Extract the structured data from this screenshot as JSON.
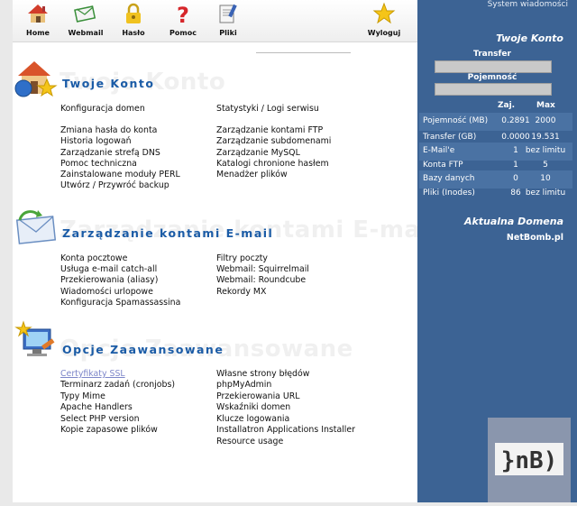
{
  "toolbar": {
    "home": "Home",
    "webmail": "Webmail",
    "password": "Hasło",
    "help": "Pomoc",
    "files": "Pliki",
    "logout": "Wyloguj"
  },
  "account": {
    "ghost": "Twoje Konto",
    "title": "Twoje Konto",
    "left": [
      "Konfiguracja domen",
      "Zmiana hasła do konta",
      "Historia logowań",
      "Zarządzanie strefą DNS",
      "Pomoc techniczna",
      "Zainstalowane moduły PERL",
      "Utwórz / Przywróć backup"
    ],
    "right": [
      "Statystyki / Logi serwisu",
      "Zarządzanie kontami FTP",
      "Zarządzanie subdomenami",
      "Zarządzanie MySQL",
      "Katalogi chronione hasłem",
      "Menadżer plików"
    ]
  },
  "email": {
    "ghost": "Zarządzanie kontami E-mail",
    "title": "Zarządzanie kontami E-mail",
    "left": [
      "Konta pocztowe",
      "Usługa e-mail catch-all",
      "Przekierowania (aliasy)",
      "Wiadomości urlopowe",
      "Konfiguracja Spamassassina"
    ],
    "right": [
      "Filtry poczty",
      "Webmail: Squirrelmail",
      "Webmail: Roundcube",
      "Rekordy MX"
    ]
  },
  "advanced": {
    "ghost": "Opcje Zaawansowane",
    "title": "Opcje Zaawansowane",
    "left": [
      "Certyfikaty SSL",
      "Terminarz zadań (cronjobs)",
      "Typy Mime",
      "Apache Handlers",
      "Select PHP version",
      "Kopie zapasowe plików"
    ],
    "right": [
      "Własne strony błędów",
      "phpMyAdmin",
      "Przekierowania URL",
      "Wskaźniki domen",
      "Klucze logowania",
      "Installatron Applications Installer",
      "Resource usage"
    ]
  },
  "sidebar": {
    "system_messages": "System wiadomości",
    "account_title": "Twoje Konto",
    "transfer_label": "Transfer",
    "capacity_label": "Pojemność",
    "col_used": "Zaj.",
    "col_max": "Max",
    "stats": [
      {
        "name": "Pojemność (MB)",
        "used": "0.2891",
        "max": "2000"
      },
      {
        "name": "Transfer (GB)",
        "used": "0.0000",
        "max": "19.531"
      },
      {
        "name": "E-Mail'e",
        "used": "1",
        "max": "bez limitu"
      },
      {
        "name": "Konta FTP",
        "used": "1",
        "max": "5"
      },
      {
        "name": "Bazy danych",
        "used": "0",
        "max": "10"
      },
      {
        "name": "Pliki (Inodes)",
        "used": "86",
        "max": "bez limitu"
      }
    ],
    "domain_title": "Aktualna Domena",
    "domain": "NetBomb.pl"
  },
  "logo": {
    "text": "}nB)"
  },
  "colors": {
    "sidebar_bg": "#3c6394",
    "title_blue": "#1a5ba6",
    "visited_link": "#7d86c9"
  }
}
